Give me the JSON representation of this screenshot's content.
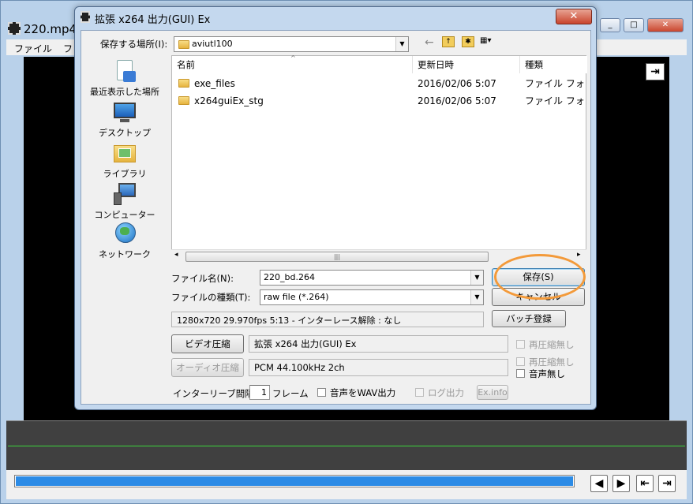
{
  "main_window": {
    "title": "220.mp4 (",
    "menu": [
      "ファイル",
      "フ"
    ],
    "caption_buttons": [
      "_",
      "□",
      "✕"
    ]
  },
  "dialog": {
    "title": "拡張 x264 出力(GUI) Ex",
    "close_label": "✕",
    "save_in_label": "保存する場所(I):",
    "save_in_value": "aviutl100",
    "places": [
      "最近表示した場所",
      "デスクトップ",
      "ライブラリ",
      "コンピューター",
      "ネットワーク"
    ],
    "columns": [
      "名前",
      "更新日時",
      "種類"
    ],
    "files": [
      {
        "name": "exe_files",
        "date": "2016/02/06 5:07",
        "type": "ファイル フォ"
      },
      {
        "name": "x264guiEx_stg",
        "date": "2016/02/06 5:07",
        "type": "ファイル フォ"
      }
    ],
    "filename_label": "ファイル名(N):",
    "filename_value": "220_bd.264",
    "filetype_label": "ファイルの種類(T):",
    "filetype_value": "raw file (*.264)",
    "save_button": "保存(S)",
    "cancel_button": "キャンセル",
    "info_text": "1280x720  29.970fps  5:13  -  インターレース解除 : なし",
    "batch_button": "バッチ登録",
    "video_button": "ビデオ圧縮",
    "video_codec": "拡張 x264 出力(GUI) Ex",
    "audio_button": "オーディオ圧縮",
    "audio_codec": "PCM 44.100kHz 2ch",
    "recompress_label_1": "再圧縮無し",
    "recompress_label_2": "再圧縮無し",
    "no_audio_label": "音声無し",
    "interleave_label": "インターリーブ間隔 :",
    "interleave_value": "1",
    "frame_unit": "フレーム",
    "wav_output_label": "音声をWAV出力",
    "log_output_label": "ログ出力",
    "exinfo_button": "Ex.info"
  }
}
